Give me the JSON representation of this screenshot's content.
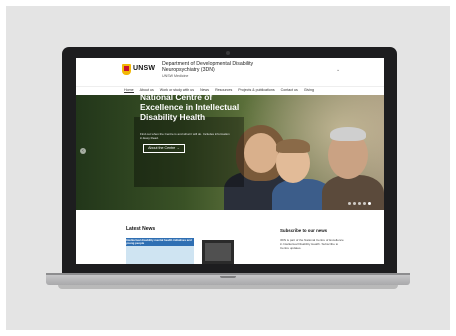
{
  "site": {
    "logo_text": "UNSW",
    "department_title": "Department of Developmental Disability Neuropsychiatry (3DN)",
    "faculty": "UNSW Medicine",
    "menu_icon": "chevron-down-icon"
  },
  "nav": {
    "items": [
      {
        "label": "Home"
      },
      {
        "label": "About us"
      },
      {
        "label": "Work or study with us"
      },
      {
        "label": "News"
      },
      {
        "label": "Resources"
      },
      {
        "label": "Projects & publications"
      },
      {
        "label": "Contact us"
      },
      {
        "label": "Giving"
      }
    ]
  },
  "hero": {
    "title": "National Centre of Excellence in Intellectual Disability Health",
    "subtitle": "Find out when the Centre is and what it will do. Includes information in Easy Read.",
    "button_label": "About the Centre →",
    "slide_count": 5,
    "active_slide": 5
  },
  "news": {
    "heading": "Latest News",
    "card_text": "Intellectual disability mental health initiatives and young people"
  },
  "subscribe": {
    "heading": "Subscribe to our news",
    "text": "3DN is part of the National Centre of Excellence in Intellectual Disability Health. Subscribe to Centre updates."
  }
}
